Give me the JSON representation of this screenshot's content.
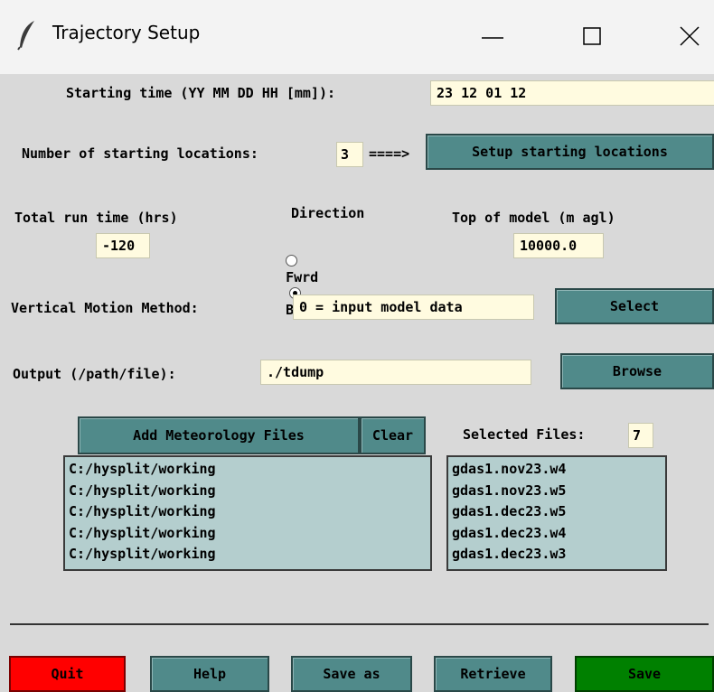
{
  "window": {
    "title": "Trajectory Setup",
    "minimize_glyph": "—",
    "close_glyph": "✕"
  },
  "starting_time": {
    "label": "Starting time (YY MM DD HH [mm]):",
    "value": "23 12 01 12"
  },
  "locations": {
    "label": "Number of starting locations:",
    "count": "3",
    "arrow": "====>",
    "setup_button": "Setup starting locations"
  },
  "run_time": {
    "label": "Total run time (hrs)",
    "value": "-120"
  },
  "direction": {
    "label": "Direction",
    "options": [
      "Fwrd",
      "Back"
    ],
    "selected": "Back"
  },
  "top_of_model": {
    "label": "Top of model (m agl)",
    "value": "10000.0"
  },
  "vertical_motion": {
    "label": "Vertical Motion Method:",
    "value": "0 = input model data",
    "select_button": "Select"
  },
  "output": {
    "label": "Output (/path/file):",
    "value": "./tdump",
    "browse_button": "Browse"
  },
  "meteorology": {
    "add_button": "Add Meteorology Files",
    "clear_button": "Clear",
    "selected_label": "Selected Files:",
    "selected_count": "7",
    "directories": [
      "C:/hysplit/working",
      "C:/hysplit/working",
      "C:/hysplit/working",
      "C:/hysplit/working",
      "C:/hysplit/working"
    ],
    "files": [
      "gdas1.nov23.w4",
      "gdas1.nov23.w5",
      "gdas1.dec23.w5",
      "gdas1.dec23.w4",
      "gdas1.dec23.w3"
    ]
  },
  "footer": {
    "quit": "Quit",
    "help": "Help",
    "save_as": "Save as",
    "retrieve": "Retrieve",
    "save": "Save"
  },
  "colors": {
    "button": "#508a8a",
    "quit": "#ff0000",
    "save": "#008000",
    "field": "#fffbe0",
    "listbox": "#b4cece",
    "background": "#d9d9d9"
  }
}
